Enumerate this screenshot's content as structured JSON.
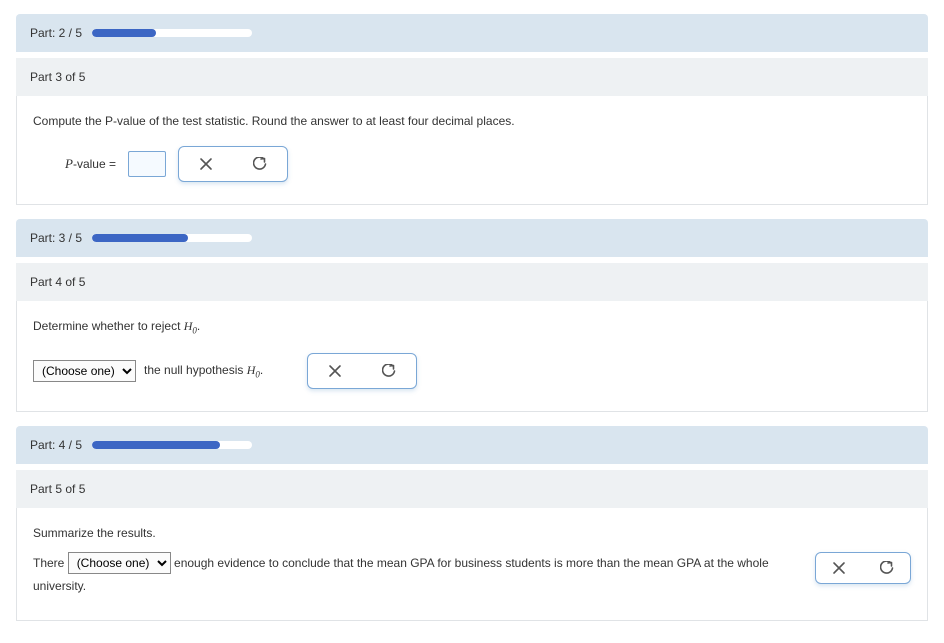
{
  "part2": {
    "headerLabel": "Part: 2 / 5",
    "progressPercent": 40
  },
  "part3": {
    "subHeader": "Part 3 of 5",
    "question": "Compute the P-value of the test statistic. Round the answer to at least four decimal places.",
    "formulaLabelPrefix": "P",
    "formulaLabelSuffix": "-value =",
    "headerLabel": "Part: 3 / 5",
    "progressPercent": 60
  },
  "part4": {
    "subHeader": "Part 4 of 5",
    "question": "Determine whether to reject ",
    "h0": "H",
    "h0sub": "0",
    "selectPlaceholder": "(Choose one)",
    "afterSelect": " the null hypothesis ",
    "headerLabel": "Part: 4 / 5",
    "progressPercent": 80
  },
  "part5": {
    "subHeader": "Part 5 of 5",
    "question": "Summarize the results.",
    "sentencePrefix": "There ",
    "selectPlaceholder": "(Choose one)",
    "sentenceSuffix": " enough evidence to conclude that the mean GPA for business students is more than the mean GPA at the whole university."
  }
}
